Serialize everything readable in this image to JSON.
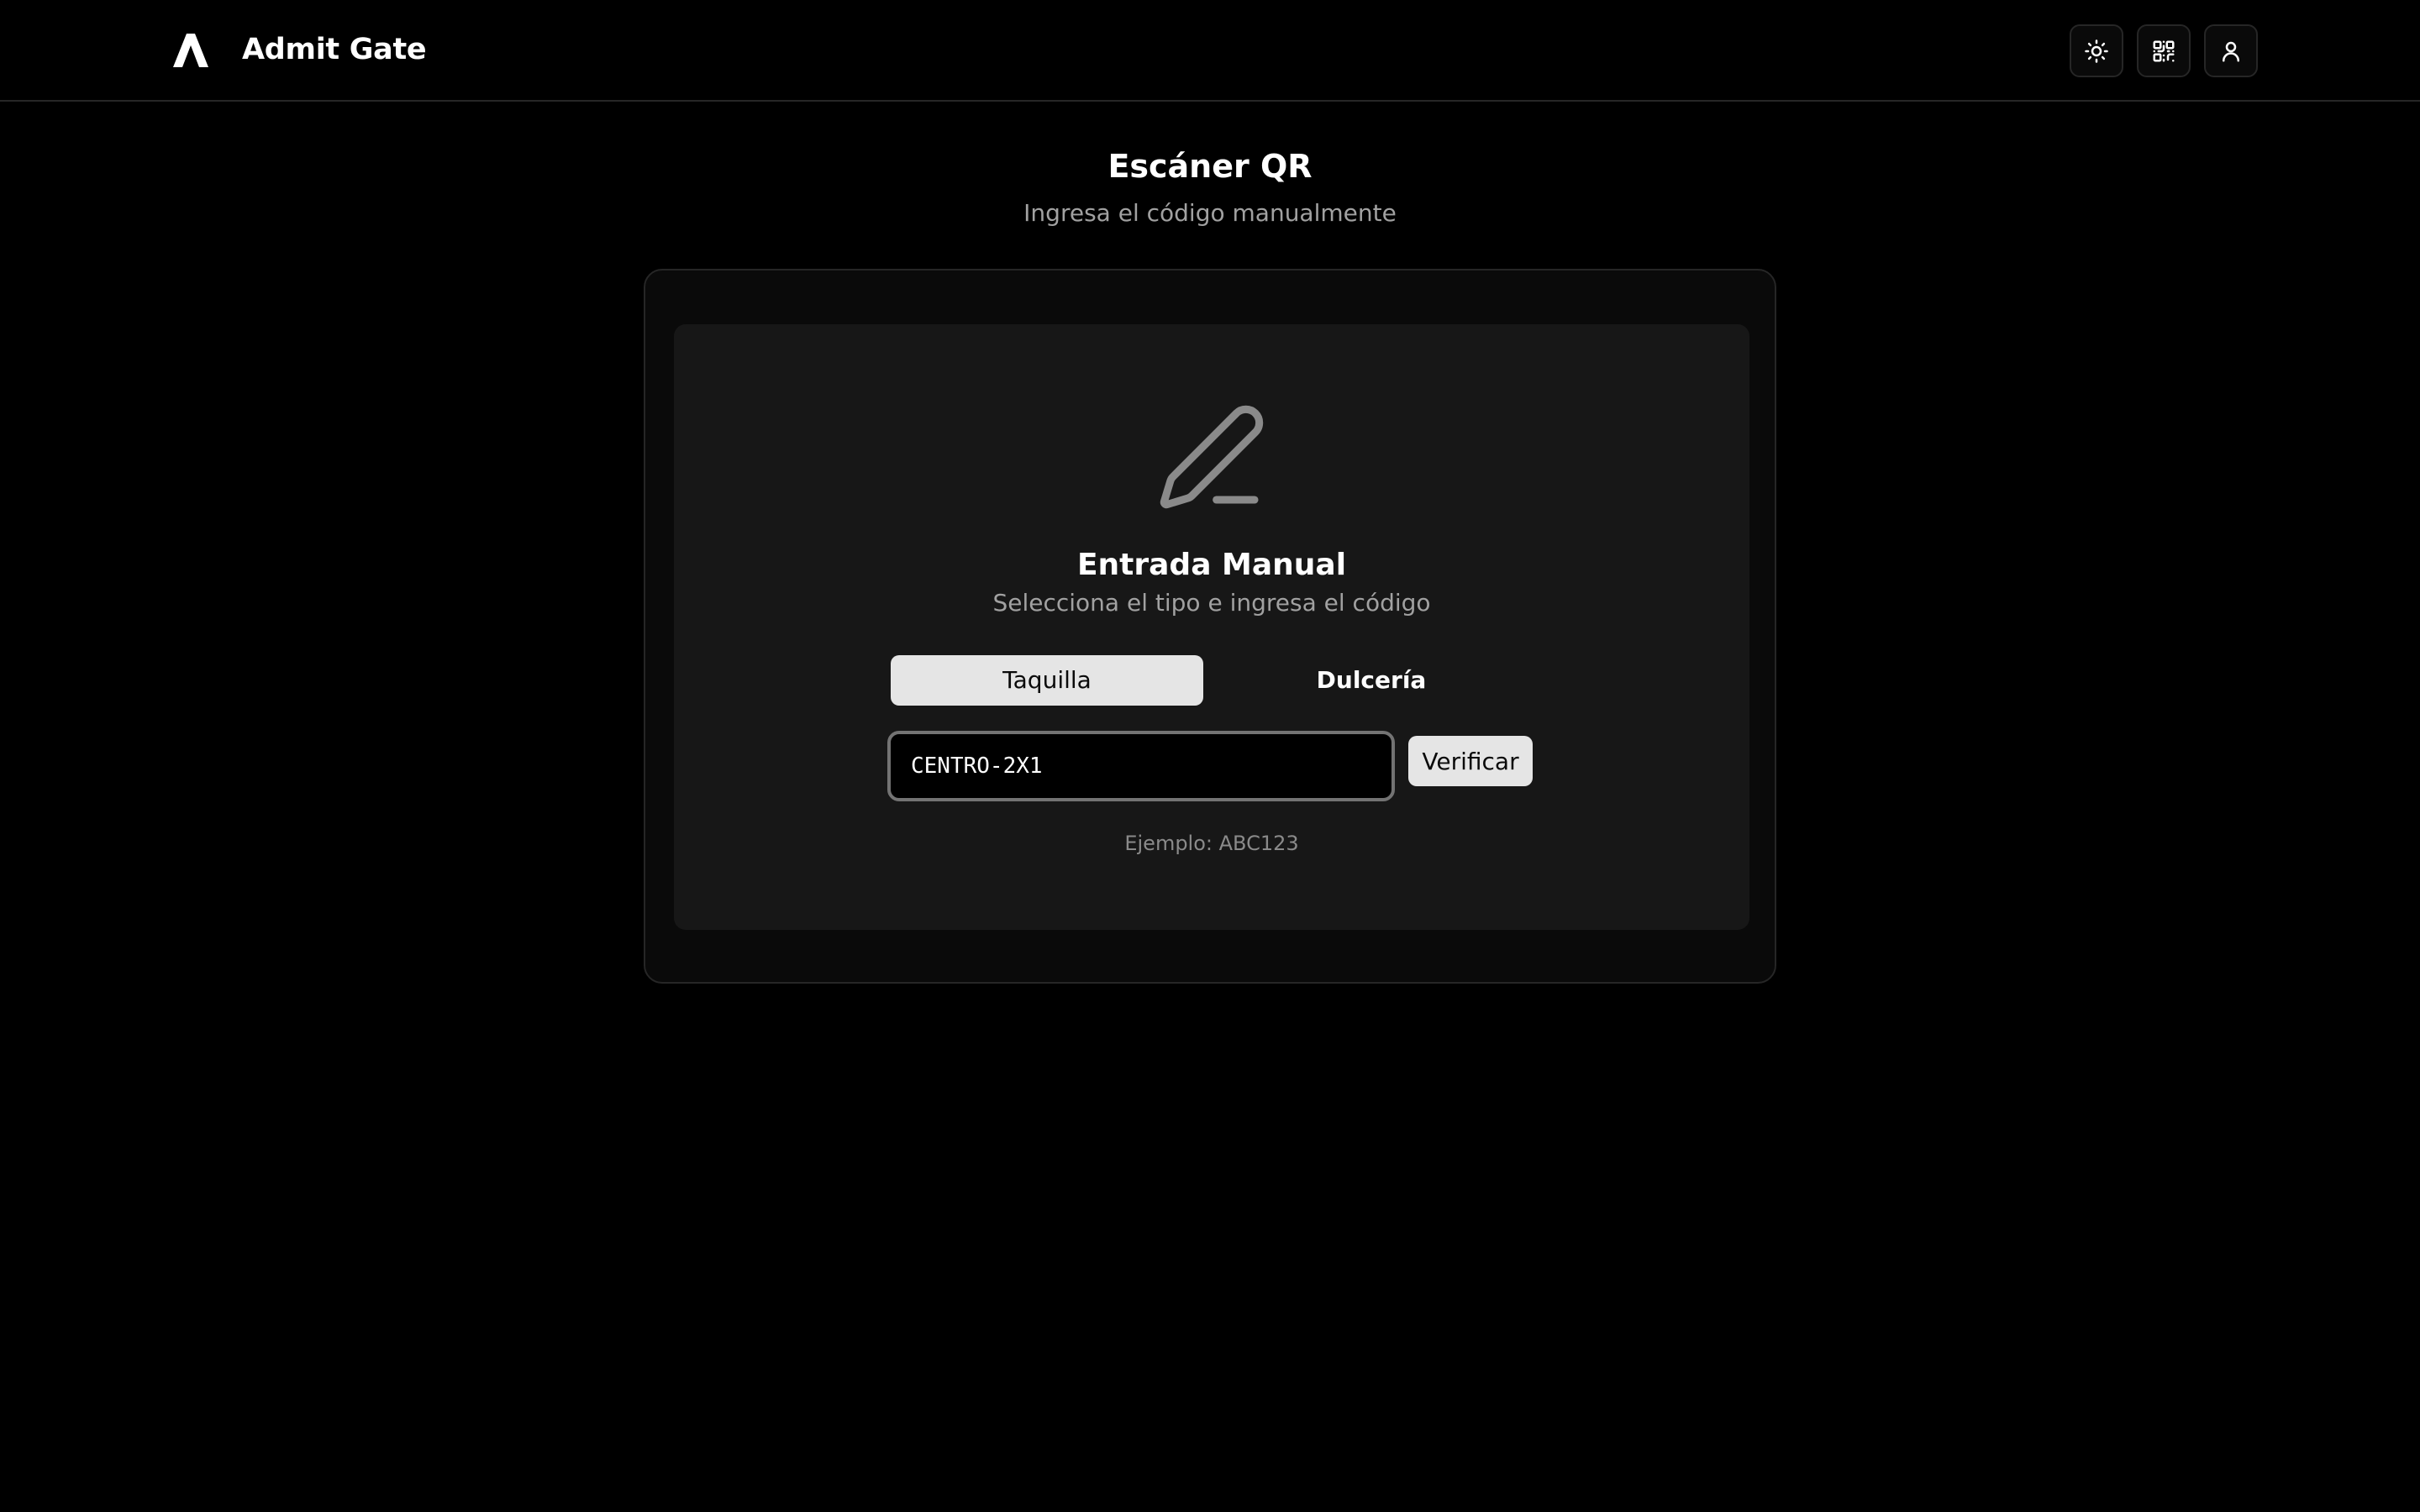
{
  "header": {
    "app_title": "Admit Gate",
    "logo_icon": "admit-gate-logo",
    "actions": [
      {
        "icon": "sun-icon",
        "purpose": "theme-toggle"
      },
      {
        "icon": "qr-code-icon",
        "purpose": "qr-scanner"
      },
      {
        "icon": "user-icon",
        "purpose": "account"
      }
    ]
  },
  "page": {
    "title": "Escáner QR",
    "subtitle": "Ingresa el código manualmente"
  },
  "manual_entry": {
    "icon": "pencil-icon",
    "title": "Entrada Manual",
    "subtitle": "Selecciona el tipo e ingresa el código",
    "tabs": [
      {
        "label": "Taquilla",
        "selected": true
      },
      {
        "label": "Dulcería",
        "selected": false
      }
    ],
    "code_input": {
      "value": "CENTRO-2X1",
      "placeholder": ""
    },
    "verify_label": "Verificar",
    "hint": "Ejemplo: ABC123"
  },
  "colors": {
    "background": "#000000",
    "card": "#0a0a0a",
    "panel": "#171717",
    "border": "#262626",
    "muted_text": "#a1a1a1",
    "active_tab": "#e5e5e5"
  }
}
